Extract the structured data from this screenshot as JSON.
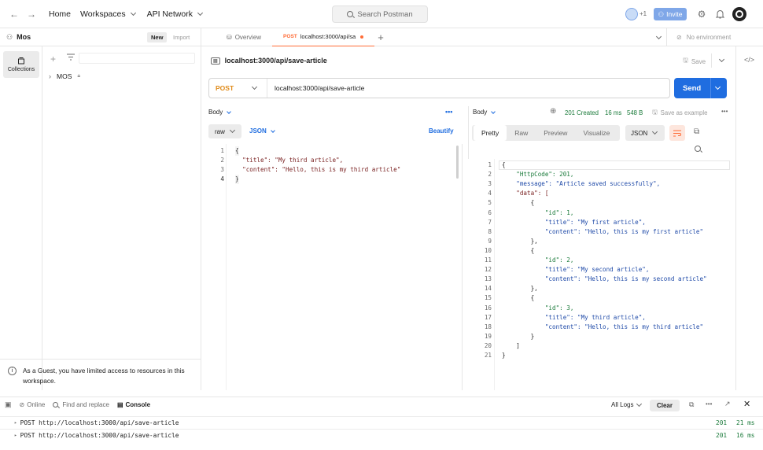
{
  "topbar": {
    "home": "Home",
    "workspaces": "Workspaces",
    "api_network": "API Network",
    "search_placeholder": "Search Postman",
    "avatar_count": "+1",
    "invite": "Invite"
  },
  "workspace": {
    "name": "Mos",
    "new_label": "New",
    "import_label": "Import"
  },
  "sidebar": {
    "collections_label": "Collections",
    "collection_name": "MOS"
  },
  "guest_notice": "As a Guest, you have limited access to resources in this workspace.",
  "tabs": {
    "overview": "Overview",
    "active_method": "POST",
    "active_title": "localhost:3000/api/sa",
    "environment": "No environment"
  },
  "request": {
    "title": "localhost:3000/api/save-article",
    "save_label": "Save",
    "method": "POST",
    "url": "localhost:3000/api/save-article",
    "send_label": "Send",
    "body_label": "Body",
    "raw_label": "raw",
    "json_label": "JSON",
    "beautify_label": "Beautify",
    "body_lines": [
      "{",
      "  \"title\": \"My third article\",",
      "  \"content\": \"Hello, this is my third article\"",
      "}"
    ]
  },
  "response": {
    "body_label": "Body",
    "status": "201 Created",
    "time": "16 ms",
    "size": "548 B",
    "save_example": "Save as example",
    "view_tabs": [
      "Pretty",
      "Raw",
      "Preview",
      "Visualize"
    ],
    "format": "JSON",
    "lines": [
      "{",
      "    \"HttpCode\": 201,",
      "    \"message\": \"Article saved successfully\",",
      "    \"data\": [",
      "        {",
      "            \"id\": 1,",
      "            \"title\": \"My first article\",",
      "            \"content\": \"Hello, this is my first article\"",
      "        },",
      "        {",
      "            \"id\": 2,",
      "            \"title\": \"My second article\",",
      "            \"content\": \"Hello, this is my second article\"",
      "        },",
      "        {",
      "            \"id\": 3,",
      "            \"title\": \"My third article\",",
      "            \"content\": \"Hello, this is my third article\"",
      "        }",
      "    ]",
      "}"
    ]
  },
  "console": {
    "online": "Online",
    "find_replace": "Find and replace",
    "console_label": "Console",
    "all_logs": "All Logs",
    "clear": "Clear",
    "logs": [
      {
        "text": "POST http://localhost:3000/api/save-article",
        "status": "201",
        "time": "21 ms"
      },
      {
        "text": "POST http://localhost:3000/api/save-article",
        "status": "201",
        "time": "16 ms"
      }
    ]
  },
  "colors": {
    "accent_orange": "#ff6c37",
    "send_blue": "#1f6de0",
    "status_green": "#1a7a3a"
  }
}
